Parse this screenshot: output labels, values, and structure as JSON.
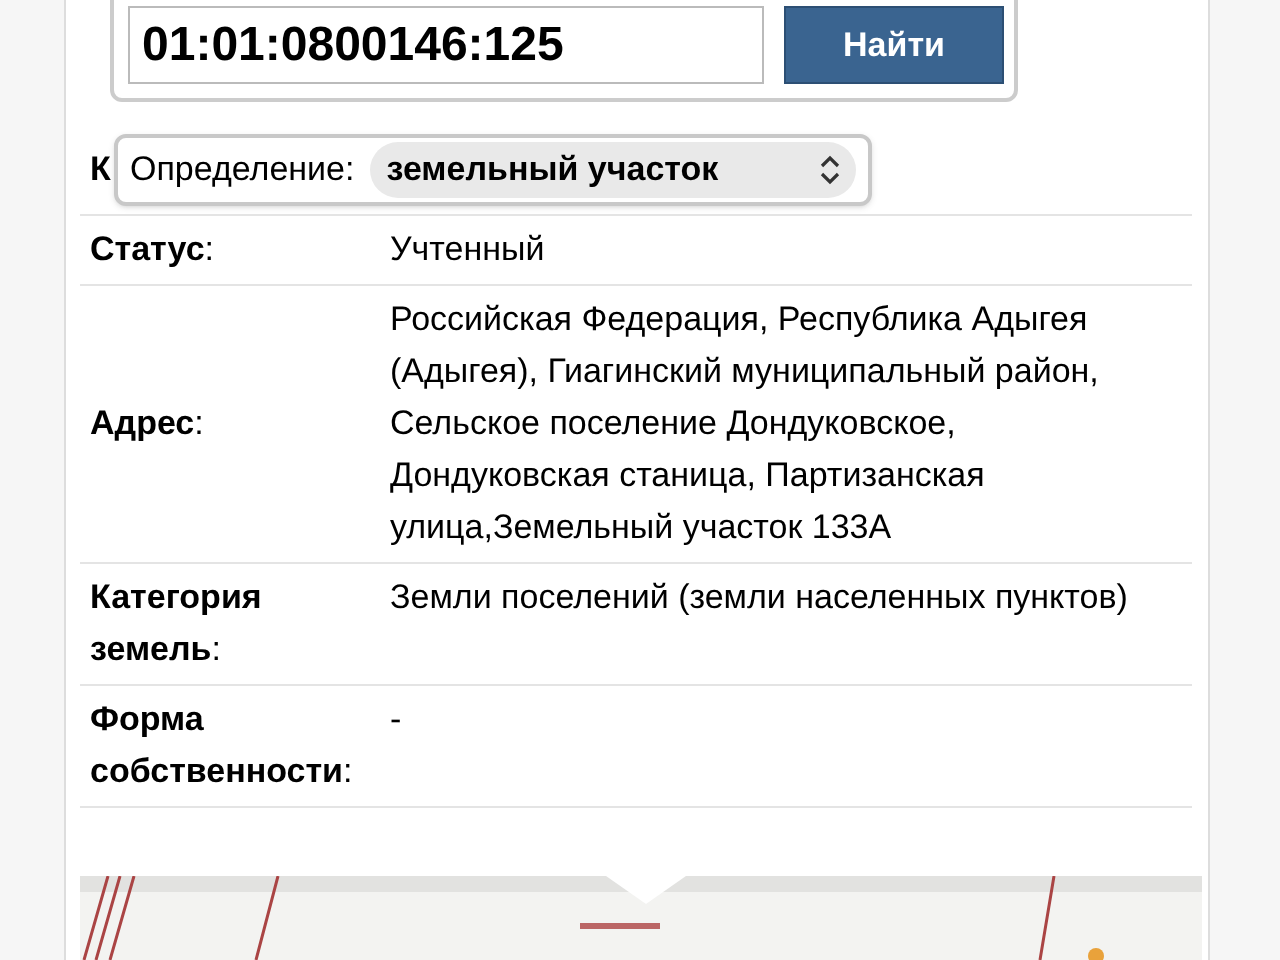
{
  "search": {
    "value": "01:01:0800146:125",
    "button": "Найти"
  },
  "definition": {
    "label": "Определение:",
    "value": "земельный участок"
  },
  "first_row_label": "К",
  "rows": [
    {
      "label": "**Статус**:",
      "value": "Учтенный"
    },
    {
      "label": "**Адрес**:",
      "value": "Российская Федерация, Республика Адыгея (Адыгея), Гиагинский муниципальный район, Сельское поселение Дондуковское, Дондуковская станица, Партизанская улица,Земельный участок 133А"
    },
    {
      "label": "**Категория земель**:",
      "value": "Земли поселений (земли населенных пунктов)"
    },
    {
      "label": "**Форма собственности**:",
      "value": "-"
    }
  ]
}
